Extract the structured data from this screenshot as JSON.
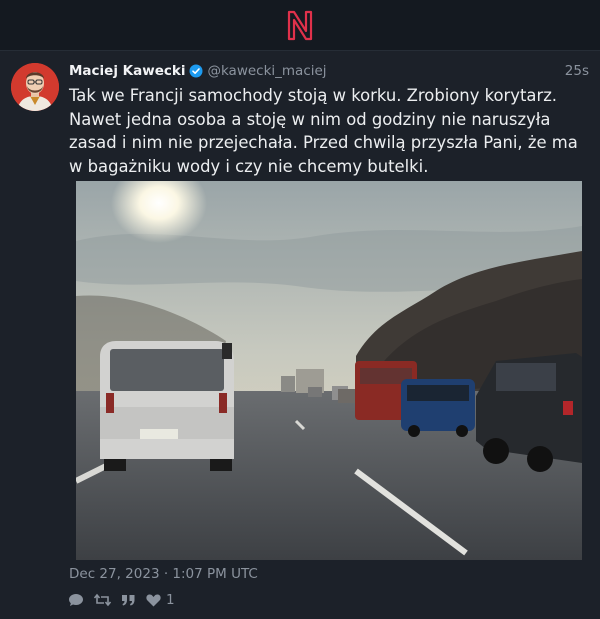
{
  "header": {
    "logo_letter": "N",
    "logo_color": "#e0314b"
  },
  "tweet": {
    "author_name": "Maciej Kawecki",
    "handle": "@kawecki_maciej",
    "verified": true,
    "time_ago": "25s",
    "text": "Tak we Francji samochody stoją w korku. Zrobiony korytarz. Nawet jedna osoba a stoję w nim od godziny nie naruszyła zasad i nim nie przejechała. Przed chwilą przyszła Pani, że ma w bagażniku wody i czy nie chcemy butelki.",
    "date": "Dec 27, 2023 · 1:07 PM UTC",
    "likes": "1",
    "avatar_bg": "#d23a2e"
  },
  "icons": {
    "reply": "speech-bubble-icon",
    "retweet": "retweet-icon",
    "quote": "quote-icon",
    "like": "heart-icon",
    "verified": "verified-badge-icon"
  }
}
